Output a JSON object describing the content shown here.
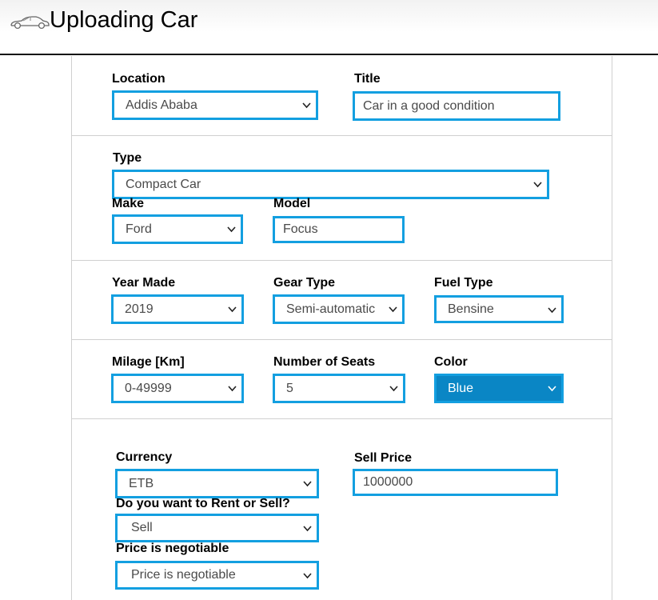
{
  "header": {
    "title": "Uploading Car",
    "logo_icon": "car-icon"
  },
  "colors": {
    "field_border": "#139fe0",
    "selected_fill": "#0a86c5"
  },
  "form": {
    "location": {
      "label": "Location",
      "value": "Addis Ababa"
    },
    "title": {
      "label": "Title",
      "value": "Car in a good condition"
    },
    "type": {
      "label": "Type",
      "value": "Compact Car"
    },
    "make": {
      "label": "Make",
      "value": "Ford"
    },
    "model": {
      "label": "Model",
      "value": "Focus"
    },
    "year_made": {
      "label": "Year Made",
      "value": "2019"
    },
    "gear_type": {
      "label": "Gear Type",
      "value": "Semi-automatic"
    },
    "fuel_type": {
      "label": "Fuel Type",
      "value": "Bensine"
    },
    "milage": {
      "label": "Milage [Km]",
      "value": "0-49999"
    },
    "seats": {
      "label": "Number of Seats",
      "value": "5"
    },
    "color": {
      "label": "Color",
      "value": "Blue"
    },
    "currency": {
      "label": "Currency",
      "value": "ETB"
    },
    "sell_price": {
      "label": "Sell Price",
      "value": "1000000"
    },
    "rent_or_sell": {
      "label": "Do you want to Rent or Sell?",
      "value": "Sell"
    },
    "negotiable": {
      "label": "Price is negotiable",
      "value": "Price is negotiable"
    }
  }
}
